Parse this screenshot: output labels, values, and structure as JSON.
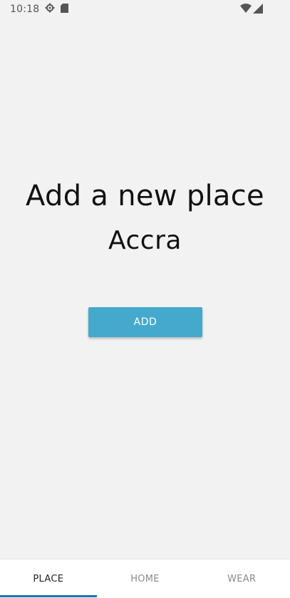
{
  "status_bar": {
    "time": "10:18",
    "icons_left": [
      "gear-icon",
      "sd-card-icon"
    ],
    "icons_right": [
      "wifi-icon",
      "cell-signal-icon"
    ]
  },
  "main": {
    "title": "Add a new place",
    "place": "Accra",
    "add_button_label": "ADD"
  },
  "tabs": [
    {
      "label": "PLACE",
      "active": true
    },
    {
      "label": "HOME",
      "active": false
    },
    {
      "label": "WEAR",
      "active": false
    }
  ],
  "colors": {
    "background": "#f2f2f2",
    "button": "#45a9cd",
    "active_tab_indicator": "#1f6fb5"
  }
}
